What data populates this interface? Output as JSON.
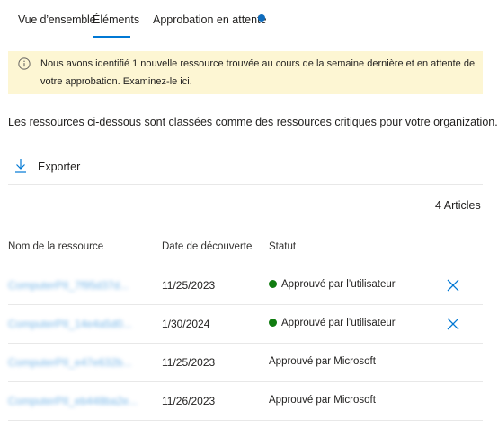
{
  "tabs": [
    {
      "label": "Vue d’ensemble"
    },
    {
      "label": "Éléments",
      "selected": true
    },
    {
      "label": "Approbation en attente",
      "has_notification": true
    }
  ],
  "banner": {
    "message": "Nous avons identifié 1 nouvelle ressource trouvée au cours de la semaine dernière et en attente de votre approbation. Examinez-le ici.",
    "icon": "info-icon",
    "background": "#fdf6d3"
  },
  "intro_text": "Les ressources ci-dessous sont classées comme des ressources critiques pour votre organization.",
  "toolbar": {
    "export_label": "Exporter",
    "export_icon": "download-icon"
  },
  "item_count": "4 Articles",
  "table": {
    "headers": [
      "Nom de la ressource",
      "Date de découverte",
      "Statut"
    ],
    "rows": [
      {
        "name": "ComputerPII_7f95d37d...",
        "date": "11/25/2023",
        "status": "Approuvé par l’utilisateur",
        "status_dot": true,
        "removable": true
      },
      {
        "name": "ComputerPII_14e4a5d0...",
        "date": "1/30/2024",
        "status": "Approuvé par l’utilisateur",
        "status_dot": true,
        "removable": true
      },
      {
        "name": "ComputerPII_e47e632b...",
        "date": "11/25/2023",
        "status": "Approuvé par Microsoft",
        "status_dot": false,
        "removable": false
      },
      {
        "name": "ComputerPII_eb448ba2e...",
        "date": "11/26/2023",
        "status": "Approuvé par Microsoft",
        "status_dot": false,
        "removable": false
      }
    ]
  },
  "colors": {
    "accent": "#0078d4",
    "success": "#107c10",
    "link": "#0078d4"
  }
}
